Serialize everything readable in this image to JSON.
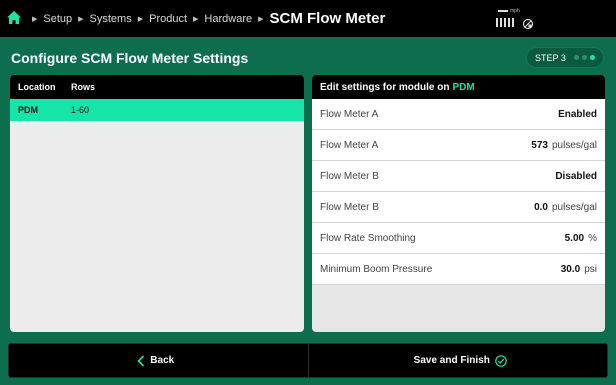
{
  "breadcrumb": {
    "items": [
      "Setup",
      "Systems",
      "Product",
      "Hardware"
    ],
    "title": "SCM Flow Meter"
  },
  "status": {
    "speed_unit": "mph",
    "gps_icon": "gps-satellite-icon"
  },
  "header": {
    "title": "Configure SCM Flow Meter Settings",
    "step_label": "STEP 3",
    "step_current": 3,
    "step_total": 3
  },
  "table": {
    "columns": [
      "Location",
      "Rows"
    ],
    "rows": [
      {
        "location": "PDM",
        "rows": "1-60"
      }
    ]
  },
  "settings": {
    "title_prefix": "Edit settings for module on",
    "module": "PDM",
    "items": [
      {
        "name": "Flow Meter A",
        "value": "Enabled",
        "unit": ""
      },
      {
        "name": "Flow Meter A",
        "value": "573",
        "unit": "pulses/gal"
      },
      {
        "name": "Flow Meter B",
        "value": "Disabled",
        "unit": ""
      },
      {
        "name": "Flow Meter B",
        "value": "0.0",
        "unit": "pulses/gal"
      },
      {
        "name": "Flow Rate Smoothing",
        "value": "5.00",
        "unit": "%"
      },
      {
        "name": "Minimum Boom Pressure",
        "value": "30.0",
        "unit": "psi"
      }
    ]
  },
  "footer": {
    "back_label": "Back",
    "finish_label": "Save and Finish"
  },
  "colors": {
    "background": "#0c6e4e",
    "accent": "#20e3a8",
    "selected_row": "#16e5aa"
  }
}
